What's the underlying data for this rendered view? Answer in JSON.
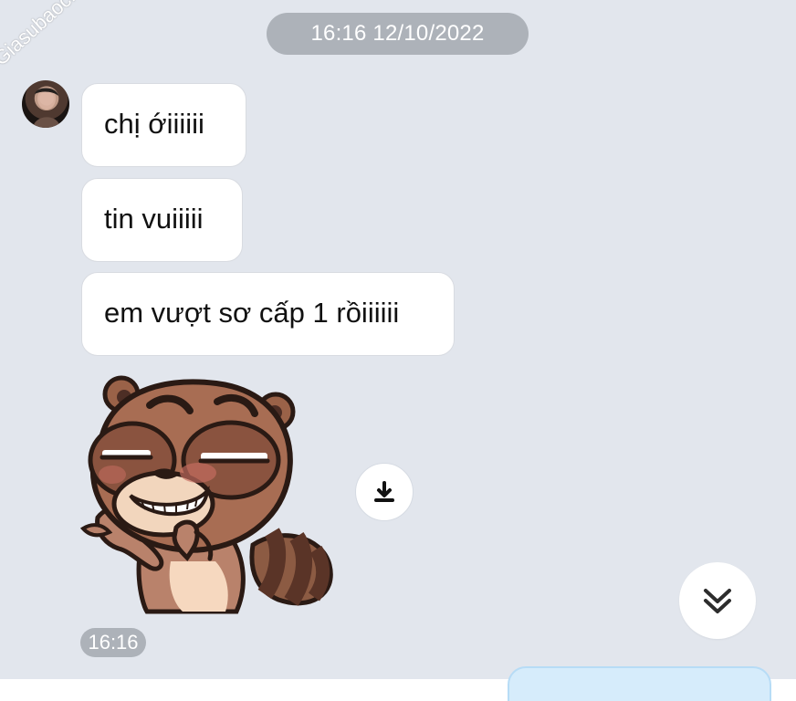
{
  "chat": {
    "date_separator": "16:16 12/10/2022",
    "watermark_text": "Giasubaochau.net",
    "messages": [
      {
        "text": "chị ớiiiiii"
      },
      {
        "text": "tin vuiiiii"
      },
      {
        "text": "em vượt sơ cấp 1 rồiiiiii"
      }
    ],
    "sticker": {
      "icon": "raccoon-sticker"
    },
    "message_time": "16:16"
  },
  "colors": {
    "background": "#e2e6ed",
    "bubble": "#ffffff",
    "pill": "#adb2b9",
    "outgoing_bubble": "#d6ecfb"
  },
  "icons": {
    "download": "download-icon",
    "scroll_down": "double-chevron-down-icon",
    "avatar": "avatar"
  }
}
